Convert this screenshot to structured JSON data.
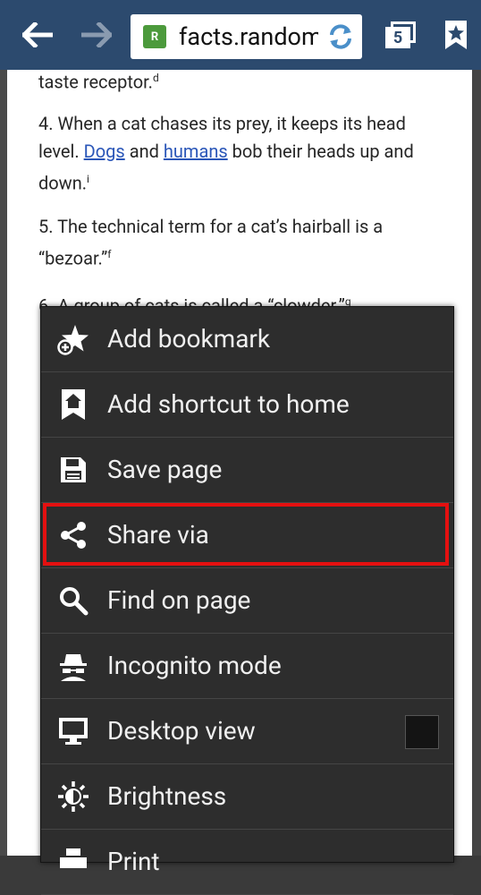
{
  "toolbar": {
    "url": "facts.random",
    "tab_count": "5"
  },
  "article": {
    "p3_tail": "taste receptor.",
    "p3_sup": "d",
    "p4_a": "4. When a cat chases its prey, it keeps its head level.",
    "p4_link1": "Dogs",
    "p4_and": "and",
    "p4_link2": "humans",
    "p4_b": "bob their heads up and down.",
    "p4_sup": "i",
    "p5": "5. The technical term for a cat’s hairball is a “bezoar.”",
    "p5_sup": "f",
    "p6": "6. A group of cats is called a “clowder.”",
    "p6_sup": "g"
  },
  "menu": {
    "items": [
      {
        "label": "Add bookmark",
        "icon": "add-bookmark-icon"
      },
      {
        "label": "Add shortcut to home",
        "icon": "home-shortcut-icon"
      },
      {
        "label": "Save page",
        "icon": "save-icon"
      },
      {
        "label": "Share via",
        "icon": "share-icon"
      },
      {
        "label": "Find on page",
        "icon": "search-icon"
      },
      {
        "label": "Incognito mode",
        "icon": "incognito-icon"
      },
      {
        "label": "Desktop view",
        "icon": "desktop-icon",
        "checkbox": false
      },
      {
        "label": "Brightness",
        "icon": "brightness-icon"
      },
      {
        "label": "Print",
        "icon": "print-icon"
      }
    ],
    "highlight_color": "#e41010"
  }
}
